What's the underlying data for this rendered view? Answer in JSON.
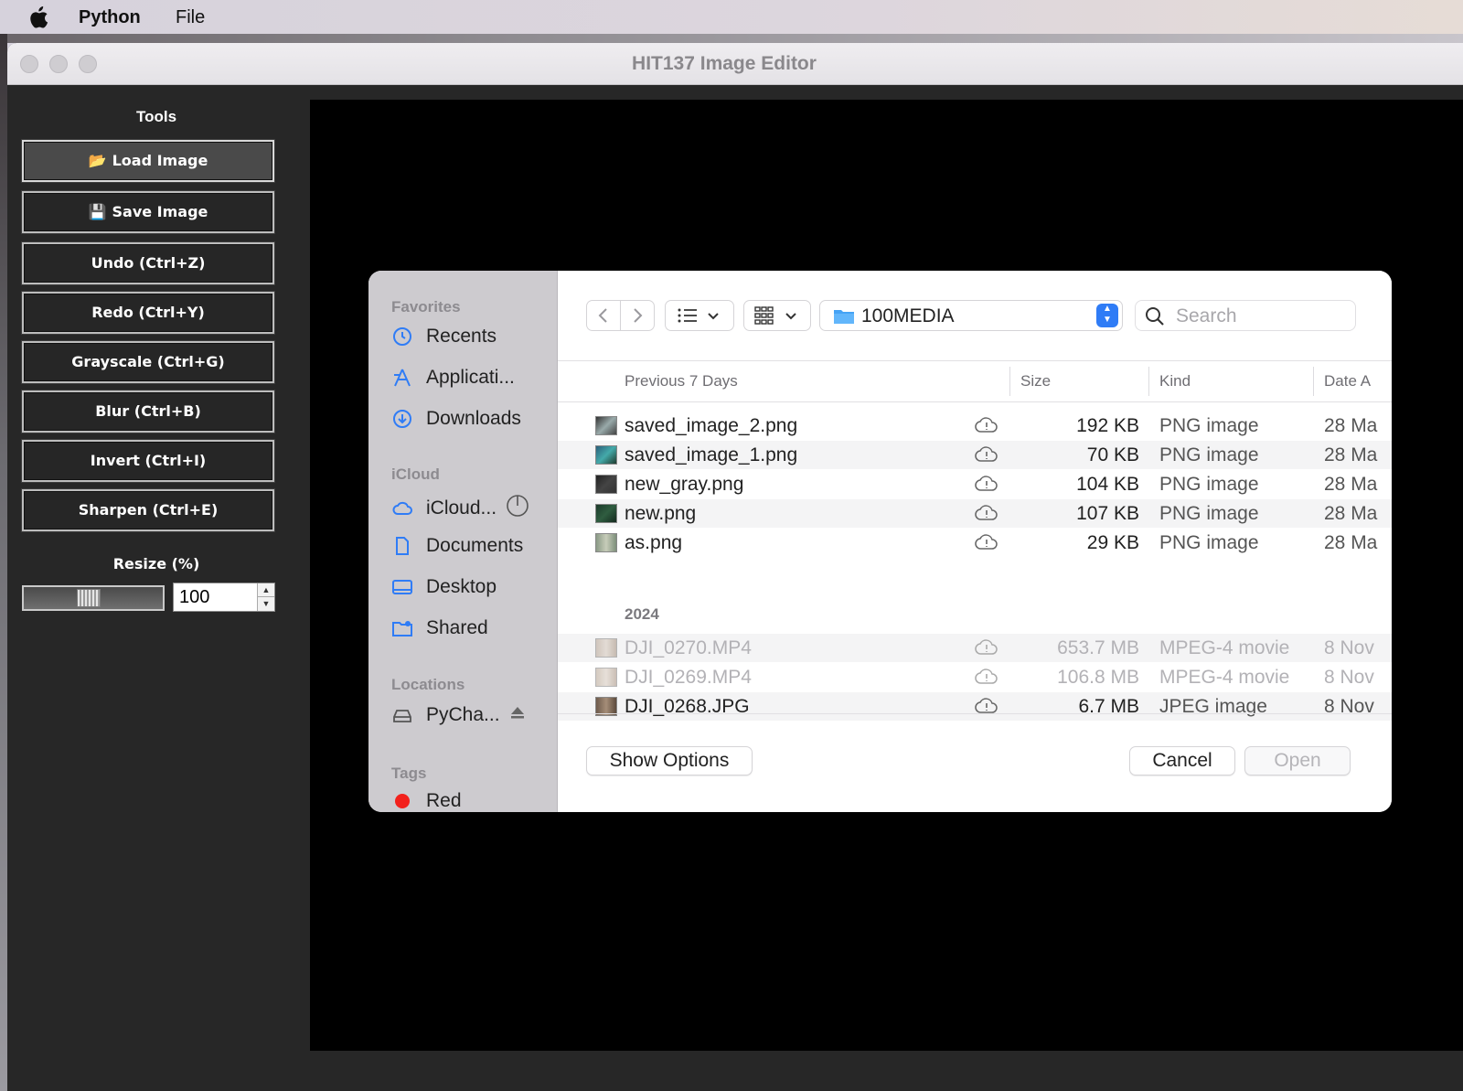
{
  "menubar": {
    "app": "Python",
    "file": "File"
  },
  "window": {
    "title": "HIT137 Image Editor"
  },
  "tools": {
    "title": "Tools",
    "buttons": [
      {
        "icon": "📂",
        "label": "Load Image"
      },
      {
        "icon": "💾",
        "label": "Save Image"
      },
      {
        "label": "Undo (Ctrl+Z)"
      },
      {
        "label": "Redo (Ctrl+Y)"
      },
      {
        "label": "Grayscale (Ctrl+G)"
      },
      {
        "label": "Blur (Ctrl+B)"
      },
      {
        "label": "Invert (Ctrl+I)"
      },
      {
        "label": "Sharpen (Ctrl+E)"
      }
    ],
    "resize_title": "Resize (%)",
    "resize_value": "100"
  },
  "dialog": {
    "sidebar": {
      "favorites_head": "Favorites",
      "recents": "Recents",
      "applications": "Applicati...",
      "downloads": "Downloads",
      "icloud_head": "iCloud",
      "icloud_drive": "iCloud...",
      "documents": "Documents",
      "desktop": "Desktop",
      "shared": "Shared",
      "locations_head": "Locations",
      "pycharm": "PyCha...",
      "tags_head": "Tags",
      "tag_red": "Red"
    },
    "folder": "100MEDIA",
    "search_placeholder": "Search",
    "columns": {
      "name": "Previous 7 Days",
      "size": "Size",
      "kind": "Kind",
      "date": "Date A"
    },
    "section_2024": "2024",
    "recent_files": [
      {
        "name": "saved_image_2.png",
        "size": "192 KB",
        "kind": "PNG image",
        "date": "28 Ma"
      },
      {
        "name": "saved_image_1.png",
        "size": "70 KB",
        "kind": "PNG image",
        "date": "28 Ma"
      },
      {
        "name": "new_gray.png",
        "size": "104 KB",
        "kind": "PNG image",
        "date": "28 Ma"
      },
      {
        "name": "new.png",
        "size": "107 KB",
        "kind": "PNG image",
        "date": "28 Ma"
      },
      {
        "name": "as.png",
        "size": "29 KB",
        "kind": "PNG image",
        "date": "28 Ma"
      }
    ],
    "older_files": [
      {
        "name": "DJI_0270.MP4",
        "size": "653.7 MB",
        "kind": "MPEG-4 movie",
        "date": "8 Nov",
        "enabled": false
      },
      {
        "name": "DJI_0269.MP4",
        "size": "106.8 MB",
        "kind": "MPEG-4 movie",
        "date": "8 Nov",
        "enabled": false
      },
      {
        "name": "DJI_0268.JPG",
        "size": "6.7 MB",
        "kind": "JPEG image",
        "date": "8 Nov",
        "enabled": true
      }
    ],
    "show_options": "Show Options",
    "cancel": "Cancel",
    "open": "Open"
  }
}
